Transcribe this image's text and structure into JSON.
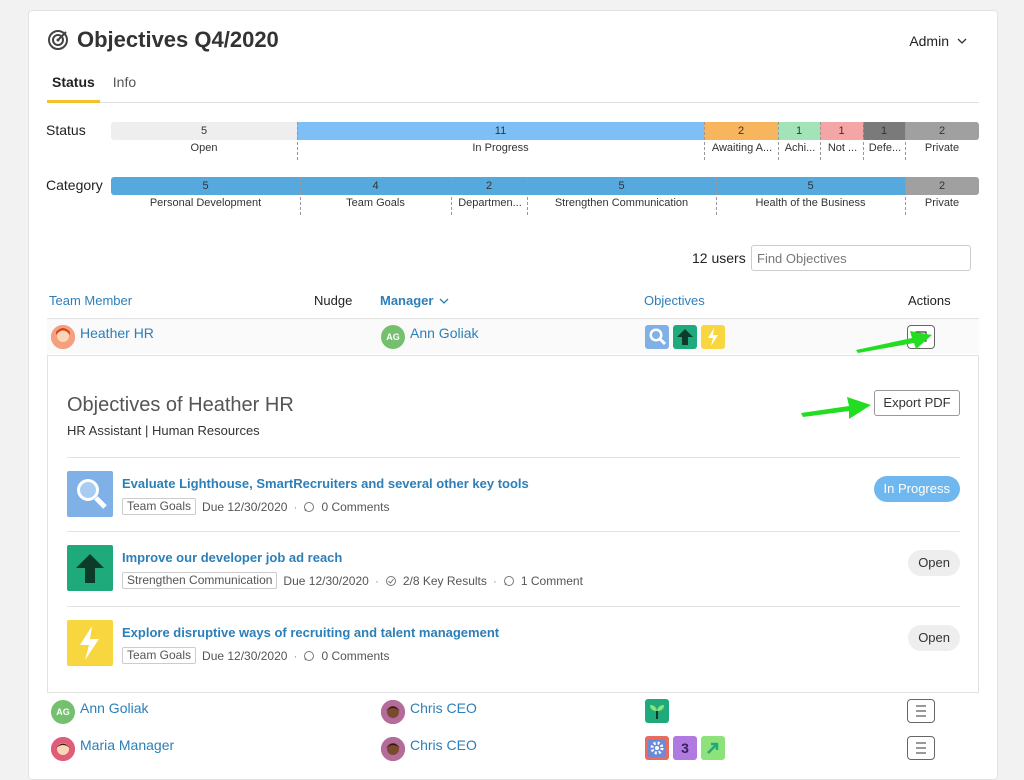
{
  "header": {
    "title": "Objectives Q4/2020",
    "user_menu": "Admin"
  },
  "tabs": [
    {
      "label": "Status",
      "active": true
    },
    {
      "label": "Info",
      "active": false
    }
  ],
  "status_bar": {
    "label": "Status",
    "segments": [
      {
        "count": "5",
        "label": "Open",
        "color": "#eeeeee"
      },
      {
        "count": "11",
        "label": "In Progress",
        "color": "#7ec0f5"
      },
      {
        "count": "2",
        "label": "Awaiting A...",
        "color": "#f7b55e"
      },
      {
        "count": "1",
        "label": "Achi...",
        "color": "#a2e4b8"
      },
      {
        "count": "1",
        "label": "Not ...",
        "color": "#f4a6a6"
      },
      {
        "count": "1",
        "label": "Defe...",
        "color": "#7a7a7a"
      },
      {
        "count": "2",
        "label": "Private",
        "color": "#a0a0a0"
      }
    ]
  },
  "category_bar": {
    "label": "Category",
    "segments": [
      {
        "count": "5",
        "label": "Personal Development",
        "color": "#56a9dc"
      },
      {
        "count": "4",
        "label": "Team Goals",
        "color": "#56a9dc"
      },
      {
        "count": "2",
        "label": "Departmen...",
        "color": "#56a9dc"
      },
      {
        "count": "5",
        "label": "Strengthen Communication",
        "color": "#56a9dc"
      },
      {
        "count": "5",
        "label": "Health of the Business",
        "color": "#56a9dc"
      },
      {
        "count": "2",
        "label": "Private",
        "color": "#a0a0a0"
      }
    ]
  },
  "users_count": "12 users",
  "search": {
    "placeholder": "Find Objectives"
  },
  "table": {
    "headers": {
      "member": "Team Member",
      "nudge": "Nudge",
      "manager": "Manager",
      "objectives": "Objectives",
      "actions": "Actions"
    },
    "rows": [
      {
        "member": "Heather HR",
        "manager": "Ann Goliak",
        "manager_initials": "AG"
      },
      {
        "member": "Ann Goliak",
        "member_initials": "AG",
        "manager": "Chris CEO"
      },
      {
        "member": "Maria Manager",
        "manager": "Chris CEO"
      }
    ]
  },
  "panel": {
    "title": "Objectives of Heather HR",
    "subtitle": "HR Assistant | Human Resources",
    "export_label": "Export PDF",
    "items": [
      {
        "title": "Evaluate Lighthouse, SmartRecruiters and several other key tools",
        "tag": "Team Goals",
        "due": "Due 12/30/2020",
        "comments": "0 Comments",
        "status": "In Progress"
      },
      {
        "title": "Improve our developer job ad reach",
        "tag": "Strengthen Communication",
        "due": "Due 12/30/2020",
        "key_results": "2/8 Key Results",
        "comments": "1 Comment",
        "status": "Open"
      },
      {
        "title": "Explore disruptive ways of recruiting and talent management",
        "tag": "Team Goals",
        "due": "Due 12/30/2020",
        "comments": "0 Comments",
        "status": "Open"
      }
    ]
  },
  "colors": {
    "accent_blue": "#2c7fb8",
    "tab_underline": "#f3c12e",
    "arrow_green": "#22dd22"
  }
}
